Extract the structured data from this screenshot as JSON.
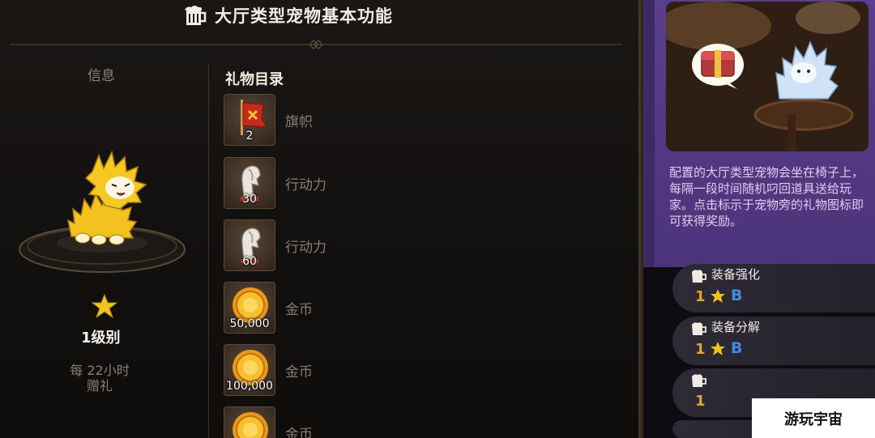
{
  "header": {
    "title": "大厅类型宠物基本功能"
  },
  "info": {
    "label": "信息",
    "level": "1级别",
    "interval_line1": "每 22小时",
    "interval_line2": "赠礼"
  },
  "gifts": {
    "title": "礼物目录",
    "items": [
      {
        "name": "旗帜",
        "qty": "2",
        "icon": "flag-icon"
      },
      {
        "name": "行动力",
        "qty": "30",
        "icon": "stamina-horse-icon"
      },
      {
        "name": "行动力",
        "qty": "60",
        "icon": "stamina-horse-icon"
      },
      {
        "name": "金币",
        "qty": "50,000",
        "icon": "gold-coin-icon"
      },
      {
        "name": "金币",
        "qty": "100,000",
        "icon": "gold-coin-icon"
      },
      {
        "name": "金币",
        "qty": "",
        "icon": "gold-coin-icon"
      }
    ]
  },
  "side": {
    "description": "配置的大厅类型宠物会坐在椅子上，每隔一段时间随机叼回道具送给玩家。点击标示于宠物旁的礼物图标即可获得奖励。",
    "cards": [
      {
        "title": "装备强化",
        "level": "1",
        "rank": "B"
      },
      {
        "title": "装备分解",
        "level": "1",
        "rank": "B"
      },
      {
        "title": "",
        "level": "1",
        "rank": ""
      }
    ]
  },
  "watermark": "游玩宇宙",
  "colors": {
    "accent_gold": "#f0b820",
    "purple_panel": "#5a3f8c",
    "rank_blue": "#3f8de0"
  }
}
